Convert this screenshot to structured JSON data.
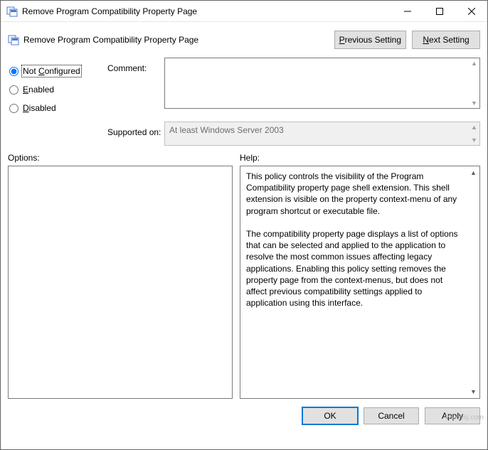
{
  "window": {
    "title": "Remove Program Compatibility Property Page"
  },
  "header": {
    "title": "Remove Program Compatibility Property Page",
    "prev_label_pre": "P",
    "prev_label_post": "revious Setting",
    "next_label_pre": "N",
    "next_label_post": "ext Setting"
  },
  "state": {
    "not_configured_label_pre": "Not ",
    "not_configured_label_u": "C",
    "not_configured_label_post": "onfigured",
    "enabled_label_u": "E",
    "enabled_label_post": "nabled",
    "disabled_label_u": "D",
    "disabled_label_post": "isabled",
    "selected": "not_configured"
  },
  "comment": {
    "label": "Comment:",
    "value": ""
  },
  "supported": {
    "label": "Supported on:",
    "value": "At least Windows Server 2003"
  },
  "options": {
    "label": "Options:"
  },
  "help": {
    "label": "Help:",
    "para1": "This policy controls the visibility of the Program Compatibility property page shell extension.  This shell extension is visible on the property context-menu of any program shortcut or executable file.",
    "para2": "The compatibility property page displays a list of options that can be selected and applied to the application to resolve the most common issues affecting legacy applications.  Enabling this policy setting removes the property page from the context-menus, but does not affect previous compatibility settings applied to application using this interface."
  },
  "buttons": {
    "ok": "OK",
    "cancel": "Cancel",
    "apply": "Apply"
  },
  "watermark": "wsxwsj.com"
}
